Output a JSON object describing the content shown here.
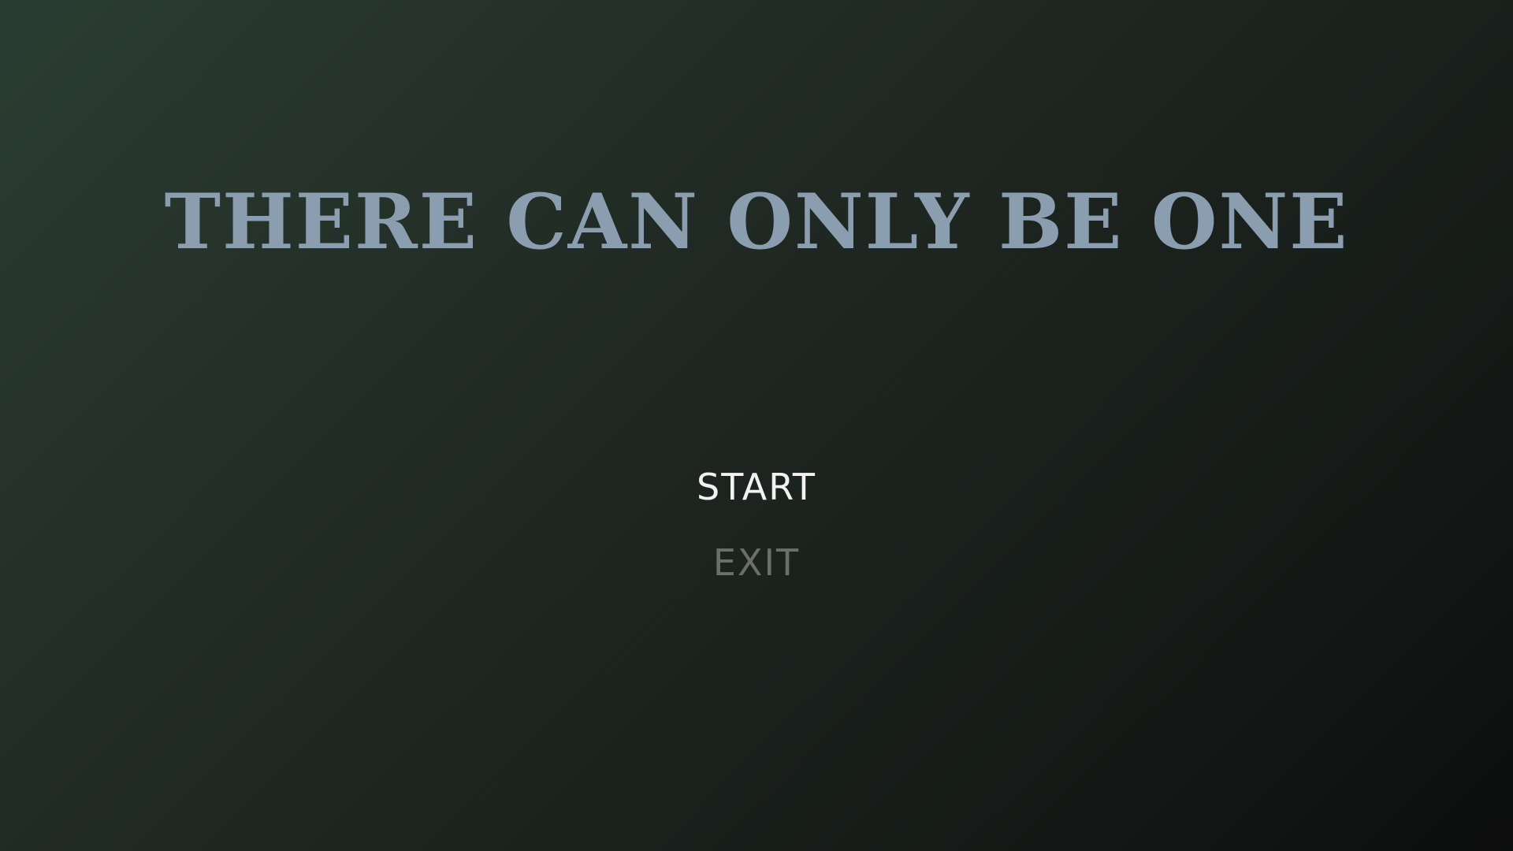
{
  "title": "THERE CAN ONLY BE ONE",
  "menu": {
    "start_label": "START",
    "exit_label": "EXIT"
  },
  "colors": {
    "title": "#8a9eaf",
    "selected": "#f2f2f2",
    "unselected": "#6b6f6c"
  }
}
